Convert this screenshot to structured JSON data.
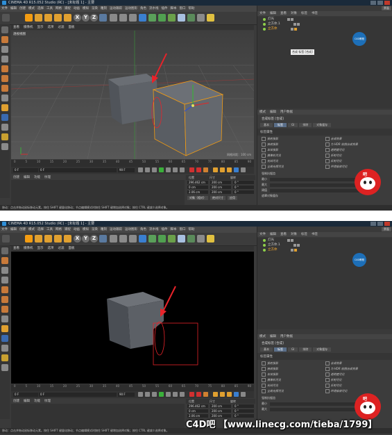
{
  "app": {
    "title": "CINEMA 4D R15.052 Studio (RC) - [未标题 1] - 主要",
    "layout_label": "界面",
    "logo_text": "C4D教程"
  },
  "menubar": [
    "文件",
    "编辑",
    "创建",
    "模式",
    "选择",
    "工具",
    "网格",
    "捕捉",
    "动画",
    "模拟",
    "渲染",
    "雕刻",
    "运动跟踪",
    "运动图形",
    "角色",
    "流水线",
    "插件",
    "脚本",
    "窗口",
    "帮助"
  ],
  "viewport": {
    "menu": [
      "查看",
      "摄像机",
      "显示",
      "选项",
      "过滤",
      "面板"
    ],
    "label": "透视视图",
    "grid_info": "网格间距：100 cm"
  },
  "timeline": {
    "ticks": [
      "0",
      "5",
      "10",
      "15",
      "20",
      "25",
      "30",
      "35",
      "40",
      "45",
      "50",
      "55",
      "60",
      "65",
      "70",
      "75",
      "80",
      "85",
      "90"
    ],
    "frame_current": "0 F",
    "frame_start": "0 F",
    "frame_end": "90 F",
    "frame_end2": "90 F",
    "current_label": "0 F"
  },
  "materials": {
    "menu": [
      "创建",
      "编辑",
      "功能",
      "纹理"
    ]
  },
  "coords": {
    "headers": [
      "位置",
      "尺寸",
      "旋转"
    ],
    "rows": [
      {
        "pos": "296.462 cm",
        "size": "200 cm",
        "rot_label": "H",
        "rot": "0 °"
      },
      {
        "pos": "0 cm",
        "size": "200 cm",
        "rot_label": "P",
        "rot": "0 °"
      },
      {
        "pos": "2.06 cm",
        "size": "200 cm",
        "rot_label": "B",
        "rot": "0 °"
      }
    ],
    "buttons": [
      "对象（相对）",
      "绝对尺寸",
      "应用"
    ]
  },
  "object_manager": {
    "menu": [
      "文件",
      "编辑",
      "查看",
      "对象",
      "标签",
      "书签"
    ],
    "objects": [
      "灯光",
      "立方体.1",
      "立方体"
    ],
    "tooltip": "合成 标签 [合成]"
  },
  "attributes": {
    "menu": [
      "模式",
      "编辑",
      "用户数据"
    ],
    "title": "合成标签 [合成]",
    "tabs": [
      "基本",
      "标签",
      "GI",
      "排除",
      "对象缓存"
    ],
    "section": "标签属性",
    "checks_left": [
      "投射投影",
      "接收投影",
      "本体投影",
      "摄像机可见",
      "光线可见",
      "全局光照可见"
    ],
    "checks_right": [
      "合成背景",
      "为 HDR 贴图合成背景",
      "透明度可见",
      "折射可见",
      "反射可见",
      "环境吸收可见"
    ],
    "fields": [
      "强制抗锯齿",
      "最小",
      "最大",
      "阈值",
      "遮罩对象缓存"
    ]
  },
  "statusbar": {
    "text": "移动：点击并拖动鼠标移动元素。按住 SHIFT 键量化移动；节点编辑模式时按住 SHIFT 键增加选择对象；按住 CTRL 键减少选择对象。"
  },
  "watermark": "C4D吧 【www.linecg.com/tieba/1799】",
  "mascot_text": "吧",
  "colors": {
    "accent": "#f39c12",
    "selection": "#ffb030",
    "arrow": "#e8232a"
  }
}
